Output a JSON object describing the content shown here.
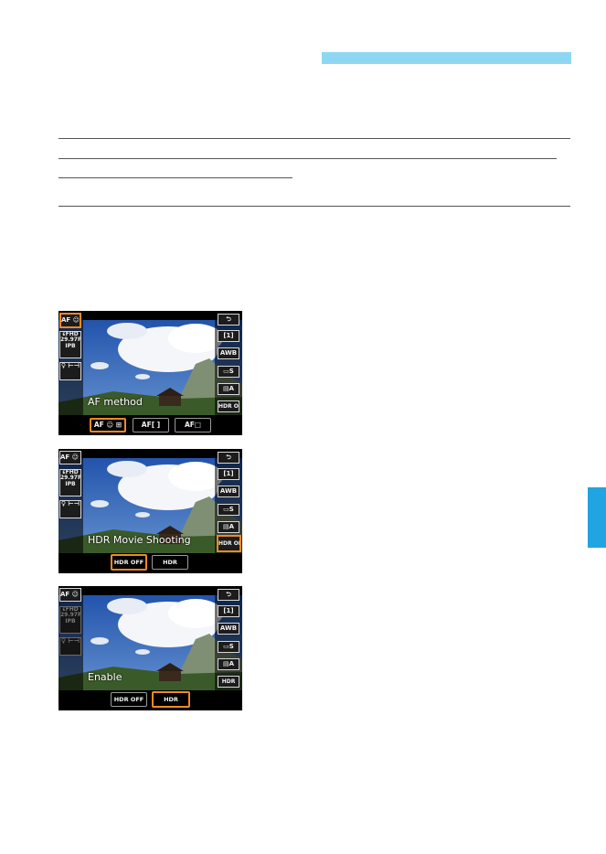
{
  "colors": {
    "header_bar": "#8ed7f3",
    "side_tab": "#20a4e2",
    "selection_frame": "#f08a24"
  },
  "screens": [
    {
      "caption": "AF method",
      "left_icons": [
        "AF ☺ ⊞",
        "ᴇFHD 29.97P IPB",
        "♀ ⊢⊣"
      ],
      "right_icons": [
        "⮌",
        "[1]",
        "AWB",
        "▭S",
        "▤A",
        "HDR OFF"
      ],
      "options": [
        "AF ☺ ⊞",
        "AF[ ]",
        "AF□"
      ],
      "selected_option": 0
    },
    {
      "caption": "HDR Movie Shooting",
      "left_icons": [
        "AF ☺ ⊞",
        "ᴇFHD 29.97P IPB",
        "♀ ⊢⊣"
      ],
      "right_icons": [
        "⮌",
        "[1]",
        "AWB",
        "▭S",
        "▤A",
        "HDR OFF"
      ],
      "options": [
        "HDR OFF",
        "HDR"
      ],
      "selected_option": 0
    },
    {
      "caption": "Enable",
      "left_icons": [
        "AF ☺ ⊞",
        "ᴇFHD 29.97P IPB",
        "♀ ⊢⊣"
      ],
      "right_icons": [
        "⮌",
        "[1]",
        "AWB",
        "▭S",
        "▤A",
        "HDR"
      ],
      "options": [
        "HDR OFF",
        "HDR"
      ],
      "selected_option": 1
    }
  ]
}
